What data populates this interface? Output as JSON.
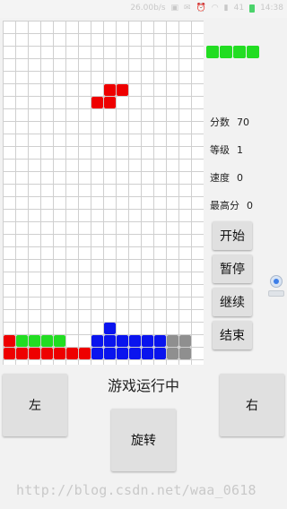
{
  "status_bar": {
    "network_speed": "26.00b/s",
    "battery": "41",
    "time": "14:38",
    "icons": [
      "image-icon",
      "mail-icon",
      "alarm-icon",
      "wifi-icon",
      "signal-icon",
      "battery-icon"
    ]
  },
  "board": {
    "columns": 16,
    "rows": 27,
    "falling_piece": {
      "color": "red",
      "cells": [
        [
          8,
          5
        ],
        [
          9,
          5
        ],
        [
          7,
          6
        ],
        [
          8,
          6
        ]
      ]
    },
    "stacked_cells": [
      {
        "color": "red",
        "cells": [
          [
            0,
            25
          ],
          [
            0,
            26
          ],
          [
            1,
            26
          ],
          [
            2,
            26
          ],
          [
            3,
            26
          ],
          [
            4,
            26
          ],
          [
            5,
            26
          ],
          [
            6,
            26
          ]
        ]
      },
      {
        "color": "green",
        "cells": [
          [
            1,
            25
          ],
          [
            2,
            25
          ],
          [
            3,
            25
          ],
          [
            4,
            25
          ]
        ]
      },
      {
        "color": "blue",
        "cells": [
          [
            8,
            24
          ],
          [
            7,
            25
          ],
          [
            8,
            25
          ],
          [
            9,
            25
          ],
          [
            10,
            25
          ],
          [
            11,
            25
          ],
          [
            12,
            25
          ],
          [
            7,
            26
          ],
          [
            8,
            26
          ],
          [
            9,
            26
          ],
          [
            10,
            26
          ],
          [
            11,
            26
          ],
          [
            12,
            26
          ]
        ]
      },
      {
        "color": "gray",
        "cells": [
          [
            13,
            25
          ],
          [
            14,
            25
          ],
          [
            13,
            26
          ],
          [
            14,
            26
          ]
        ]
      }
    ]
  },
  "next_piece": {
    "color": "green",
    "cells": [
      [
        0,
        0
      ],
      [
        1,
        0
      ],
      [
        2,
        0
      ],
      [
        3,
        0
      ]
    ]
  },
  "colors": {
    "red": "#ee0000",
    "green": "#22dd22",
    "blue": "#0a14ee",
    "gray": "#8f8f8f"
  },
  "stats": {
    "score_label": "分数",
    "score_value": "70",
    "level_label": "等级",
    "level_value": "1",
    "speed_label": "速度",
    "speed_value": "0",
    "high_score_label": "最高分",
    "high_score_value": "0"
  },
  "side_buttons": {
    "start": "开始",
    "pause": "暂停",
    "resume": "继续",
    "end": "结束"
  },
  "game_status": "游戏运行中",
  "controls": {
    "left": "左",
    "right": "右",
    "rotate": "旋转"
  },
  "watermark": "http://blog.csdn.net/waa_0618"
}
